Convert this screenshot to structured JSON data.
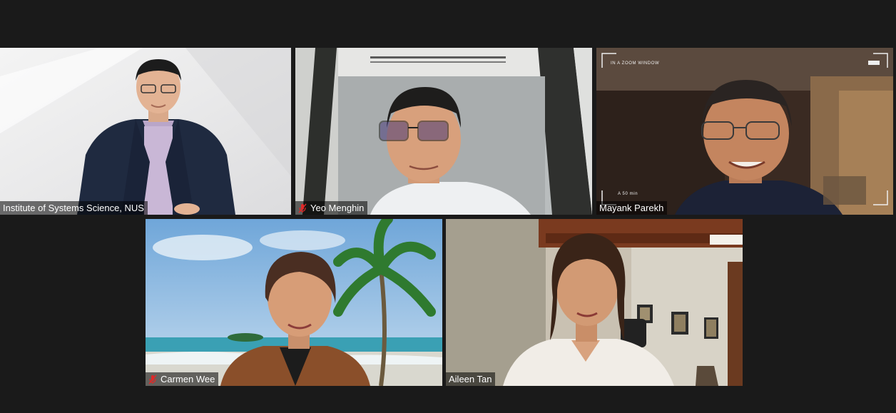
{
  "meeting": {
    "participants": [
      {
        "name": "Institute of Systems Science, NUS",
        "muted": false
      },
      {
        "name": "Yeo Menghin",
        "muted": true
      },
      {
        "name": "Mayank Parekh",
        "muted": false
      },
      {
        "name": "Carmen Wee",
        "muted": true
      },
      {
        "name": "Aileen Tan",
        "muted": false
      }
    ]
  },
  "overlays": {
    "zoom_window_label": "IN A ZOOM WINDOW",
    "camera_readout": "A 50 min"
  },
  "icons": {
    "muted_mic": "muted-microphone-icon"
  },
  "colors": {
    "background": "#1a1a1a",
    "mute_red": "#e02828",
    "nametag_text": "#ffffff"
  }
}
